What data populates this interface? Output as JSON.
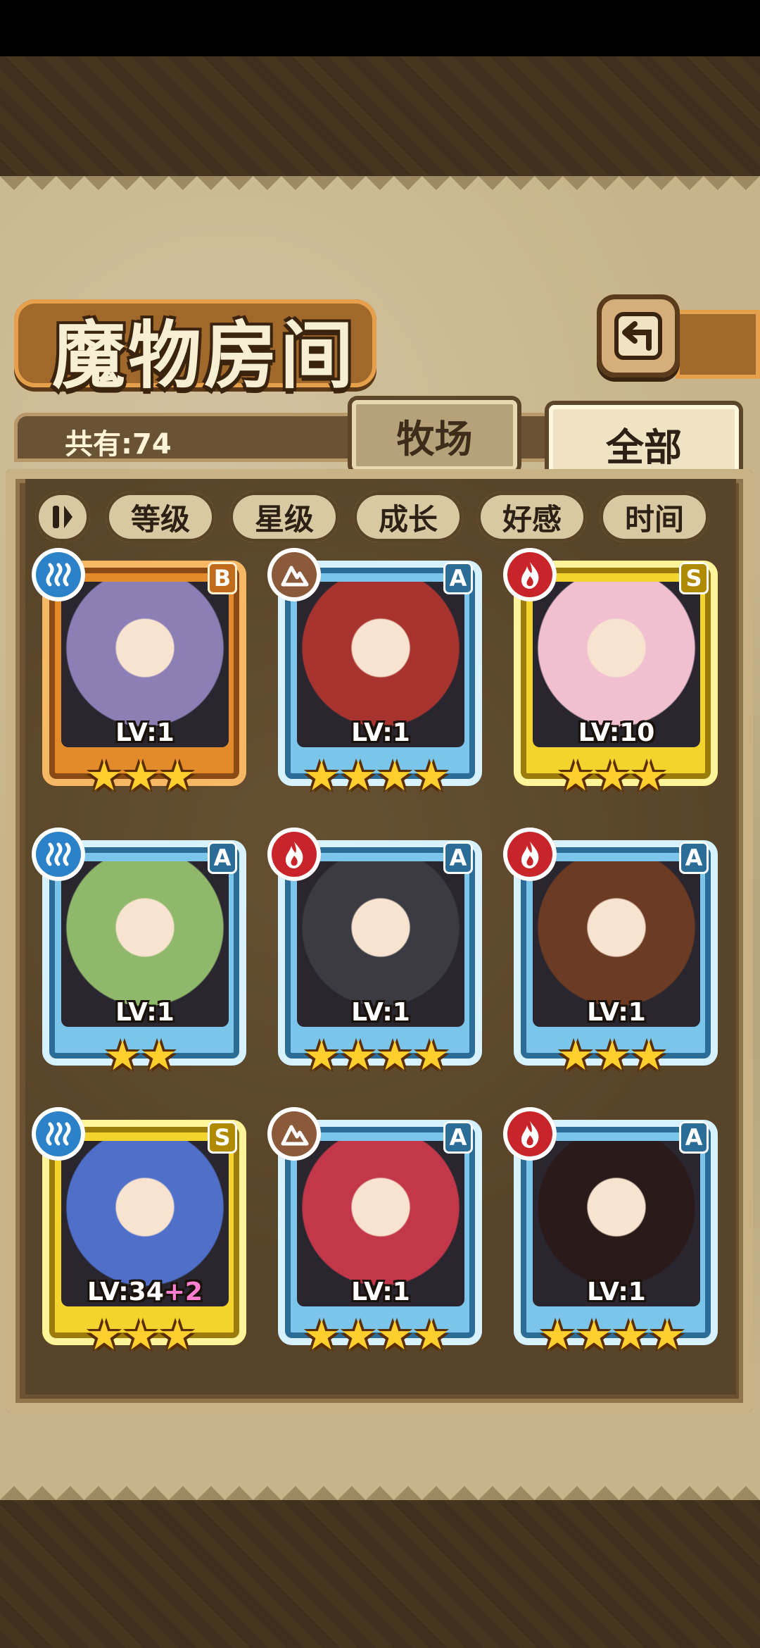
{
  "screen": {
    "title": "魔物房间",
    "owned_count": "共有:74",
    "tabs": [
      {
        "label": "牧场",
        "selected": false
      },
      {
        "label": "全部",
        "selected": true
      }
    ],
    "sort_toggle_icon": "pause-icon",
    "sort_buttons": [
      "等级",
      "星级",
      "成长",
      "好感",
      "时间"
    ]
  },
  "monsters": [
    {
      "element": "water",
      "grade": "B",
      "frame": "bronze",
      "level": "LV:1",
      "level_bonus": "",
      "stars": 3,
      "portrait_color": "#8d7fb5"
    },
    {
      "element": "earth",
      "grade": "A",
      "frame": "blue",
      "level": "LV:1",
      "level_bonus": "",
      "stars": 4,
      "portrait_color": "#a8342f"
    },
    {
      "element": "fire",
      "grade": "S",
      "frame": "gold",
      "level": "LV:10",
      "level_bonus": "",
      "stars": 3,
      "portrait_color": "#f0bfd0"
    },
    {
      "element": "water",
      "grade": "A",
      "frame": "blue",
      "level": "LV:1",
      "level_bonus": "",
      "stars": 2,
      "portrait_color": "#8fb86b"
    },
    {
      "element": "fire",
      "grade": "A",
      "frame": "blue",
      "level": "LV:1",
      "level_bonus": "",
      "stars": 4,
      "portrait_color": "#3c3b44"
    },
    {
      "element": "fire",
      "grade": "A",
      "frame": "blue",
      "level": "LV:1",
      "level_bonus": "",
      "stars": 3,
      "portrait_color": "#6b3b24"
    },
    {
      "element": "water",
      "grade": "S",
      "frame": "gold",
      "level": "LV:34",
      "level_bonus": "+2",
      "stars": 3,
      "portrait_color": "#4f6fc9"
    },
    {
      "element": "earth",
      "grade": "A",
      "frame": "blue",
      "level": "LV:1",
      "level_bonus": "",
      "stars": 4,
      "portrait_color": "#c2384a"
    },
    {
      "element": "fire",
      "grade": "A",
      "frame": "blue",
      "level": "LV:1",
      "level_bonus": "",
      "stars": 4,
      "portrait_color": "#2a1a1a"
    }
  ],
  "colors": {
    "water": "#2b82c8",
    "earth": "#8b5a3a",
    "fire": "#c8242a",
    "star": "#ffcf2e"
  }
}
